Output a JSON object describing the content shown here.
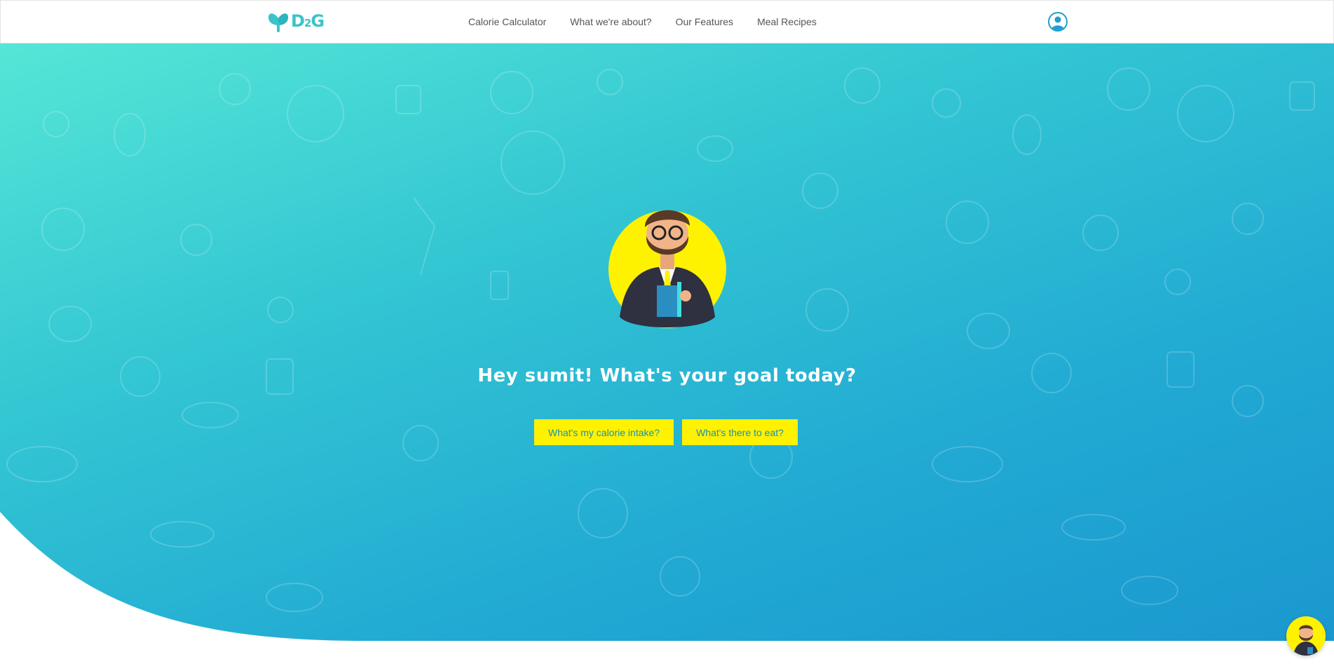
{
  "brand": {
    "logo_text_1": "D",
    "logo_text_2": "2",
    "logo_text_3": "G",
    "color": "#3cc3c9"
  },
  "nav": {
    "links": [
      {
        "label": "Calorie Calculator"
      },
      {
        "label": "What we're about?"
      },
      {
        "label": "Our Features"
      },
      {
        "label": "Meal Recipes"
      }
    ],
    "account_icon": "user-circle-icon"
  },
  "hero": {
    "greeting": "Hey sumit! What's your goal today?",
    "buttons": [
      {
        "label": "What's my calorie intake?"
      },
      {
        "label": "What's there to eat?"
      }
    ],
    "gradient_colors": [
      "#55e6d6",
      "#1a98cf"
    ],
    "accent": "#fff200"
  },
  "chat_bot": {
    "icon": "assistant-avatar-icon"
  }
}
